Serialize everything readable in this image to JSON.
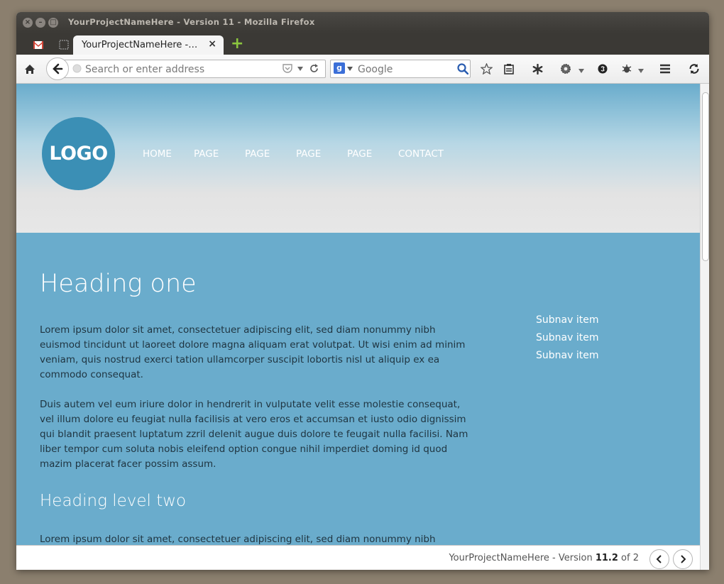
{
  "window": {
    "title": "YourProjectNameHere - Version 11 - Mozilla Firefox",
    "controls": [
      "close-icon",
      "minimize-icon",
      "maximize-icon"
    ]
  },
  "tabs": {
    "pinned": [
      "gmail-icon",
      "pinned-tab-icon"
    ],
    "active_label": "YourProjectNameHere -…",
    "close_symbol": "×",
    "new_tab_symbol": "+"
  },
  "toolbar": {
    "url_placeholder": "Search or enter address",
    "search_engine_badge": "g",
    "search_placeholder": "Google"
  },
  "site": {
    "logo_text": "LOGO",
    "nav": [
      "HOME",
      "PAGE",
      "PAGE",
      "PAGE",
      "PAGE",
      "CONTACT"
    ],
    "heading_one": "Heading one",
    "paragraph_1": "Lorem ipsum dolor sit amet, consectetuer adipiscing elit, sed diam nonummy nibh euismod tincidunt ut laoreet dolore magna aliquam erat volutpat. Ut wisi enim ad minim veniam, quis nostrud exerci tation ullamcorper suscipit lobortis nisl ut aliquip ex ea commodo consequat.",
    "paragraph_2": "Duis autem vel eum iriure dolor in hendrerit in vulputate velit esse molestie consequat, vel illum dolore eu feugiat nulla facilisis at vero eros et accumsan et iusto odio dignissim qui blandit praesent luptatum zzril delenit augue duis dolore te feugait nulla facilisi. Nam liber tempor cum soluta nobis eleifend option congue nihil imperdiet doming id quod mazim placerat facer possim assum.",
    "heading_two": "Heading level two",
    "paragraph_3": "Lorem ipsum dolor sit amet, consectetuer adipiscing elit, sed diam nonummy nibh euismod tincidunt ut laoreet dolore magna aliquam erat volutpat. Ut wisi enim ad minim veniam, quis",
    "subnav": [
      "Subnav item",
      "Subnav item",
      "Subnav item"
    ]
  },
  "findbar": {
    "project": "YourProjectNameHere",
    "separator": "-",
    "version_label": "Version",
    "version_value": "11.2",
    "of_label": "of",
    "total": "2",
    "prev_symbol": "‹",
    "next_symbol": "›"
  },
  "colors": {
    "page_blue": "#6aaccc",
    "logo_blue": "#3b8fb5",
    "header_grey": "#e7e7e7",
    "titlebar": "#3b3935"
  }
}
